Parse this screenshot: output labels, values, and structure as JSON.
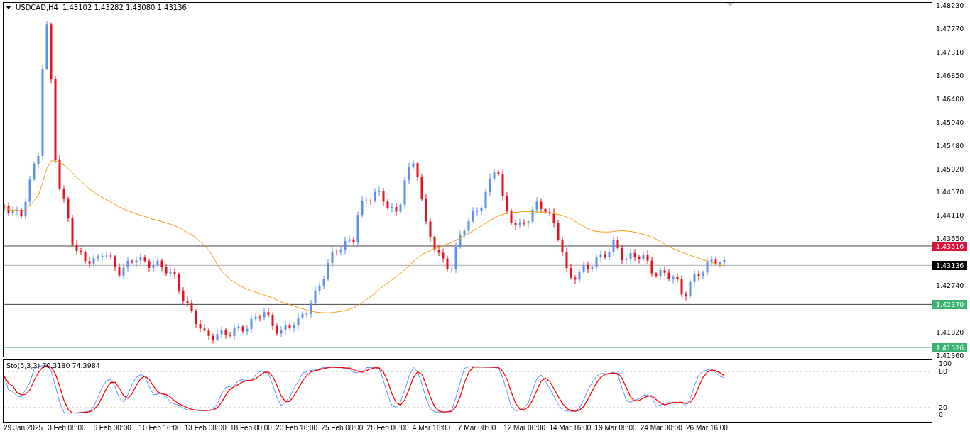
{
  "header": {
    "symbol": "USDCAD,H4",
    "ohlc": "1.43102 1.43282 1.43080 1.43136"
  },
  "price_axis": {
    "ticks": [
      "1.48230",
      "1.47770",
      "1.47310",
      "1.46850",
      "1.46400",
      "1.45940",
      "1.45480",
      "1.45020",
      "1.44570",
      "1.44110",
      "1.43650",
      "1.42740",
      "1.41820",
      "1.41360"
    ]
  },
  "price_labels": [
    {
      "text": "1.43516",
      "color": "#dc143c"
    },
    {
      "text": "1.43136",
      "color": "#000000"
    },
    {
      "text": "1.42370",
      "color": "#3cb371"
    },
    {
      "text": "1.41526",
      "color": "#3cb371"
    }
  ],
  "oscillator": {
    "label": "Sto(5,3,3) 70.3180 74.3984",
    "ticks": [
      "100",
      "80",
      "20",
      "0"
    ]
  },
  "time_axis": [
    "29 Jan 2025",
    "3 Feb 08:00",
    "6 Feb 00:00",
    "10 Feb 16:00",
    "13 Feb 08:00",
    "18 Feb 00:00",
    "20 Feb 16:00",
    "25 Feb 08:00",
    "28 Feb 00:00",
    "4 Mar 16:00",
    "7 Mar 08:00",
    "12 Mar 00:00",
    "14 Mar 16:00",
    "19 Mar 08:00",
    "24 Mar 00:00",
    "26 Mar 16:00"
  ]
}
